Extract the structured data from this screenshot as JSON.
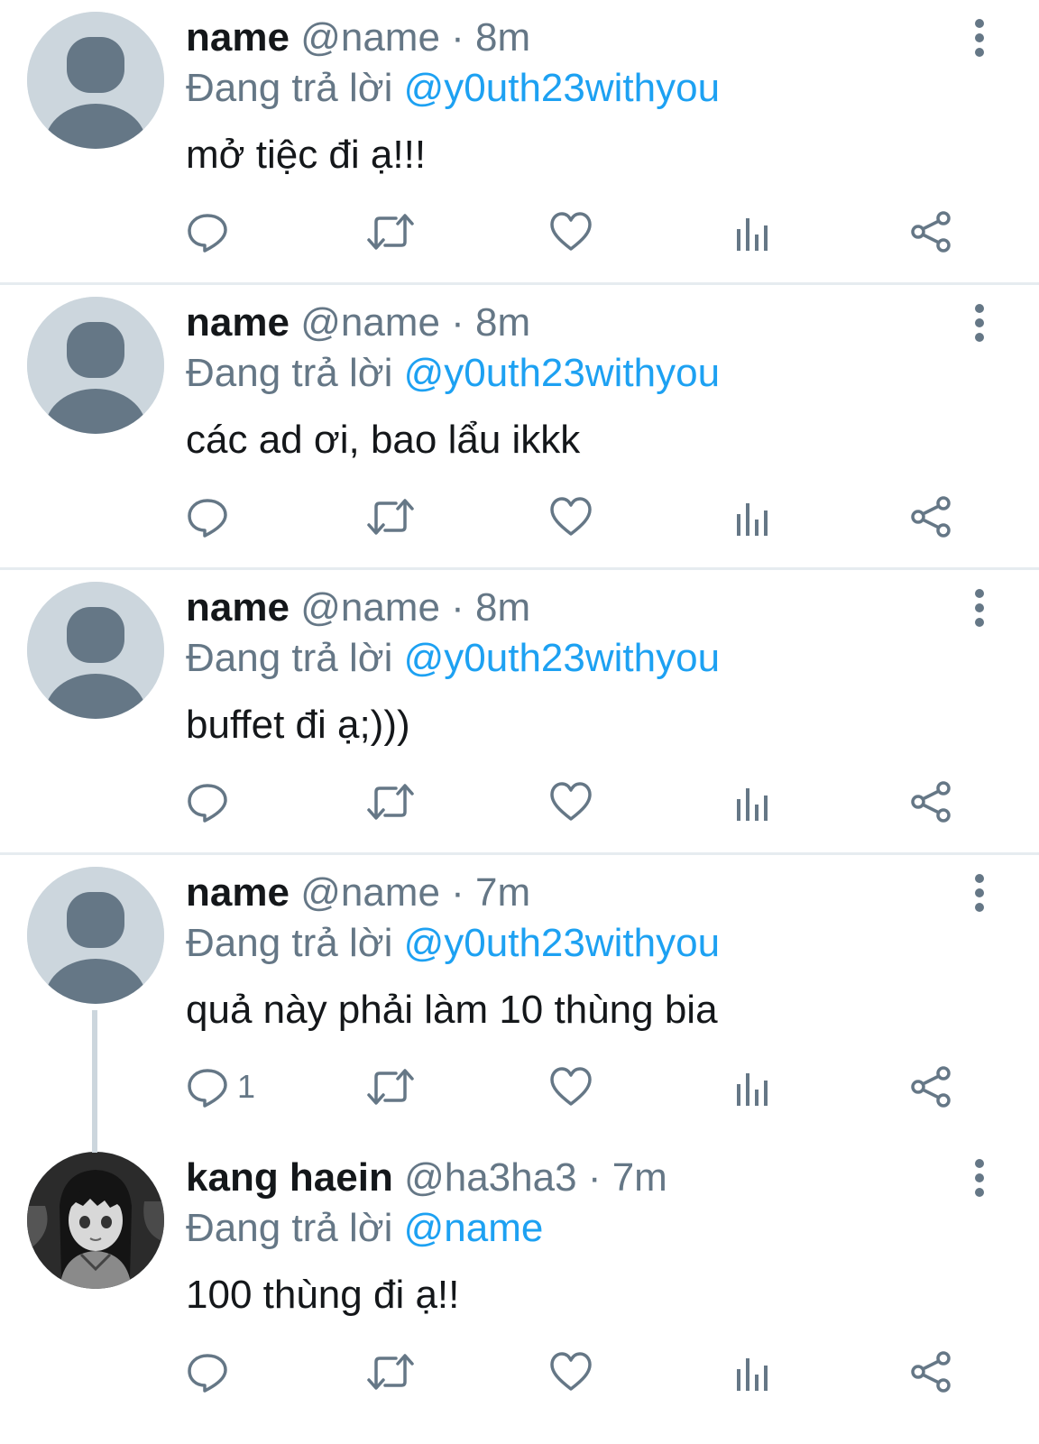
{
  "colors": {
    "text": "#14171a",
    "secondary": "#657786",
    "link": "#1da1f2",
    "divider": "#e6ecf0",
    "avatar_bg": "#ccd6dd",
    "avatar_fg": "#657786"
  },
  "tweets": [
    {
      "name": "name",
      "handle": "@name",
      "separator": "·",
      "time": "8m",
      "reply_prefix": "Đang trả lời",
      "reply_to": "@y0uth23withyou",
      "text": "mở tiệc đi ạ!!!",
      "reply_count": "",
      "avatar": "default-avatar"
    },
    {
      "name": "name",
      "handle": "@name",
      "separator": "·",
      "time": "8m",
      "reply_prefix": "Đang trả lời",
      "reply_to": "@y0uth23withyou",
      "text": "các ad ơi, bao lẩu ikkk",
      "reply_count": "",
      "avatar": "default-avatar"
    },
    {
      "name": "name",
      "handle": "@name",
      "separator": "·",
      "time": "8m",
      "reply_prefix": "Đang trả lời",
      "reply_to": "@y0uth23withyou",
      "text": "buffet đi ạ;)))",
      "reply_count": "",
      "avatar": "default-avatar"
    },
    {
      "name": "name",
      "handle": "@name",
      "separator": "·",
      "time": "7m",
      "reply_prefix": "Đang trả lời",
      "reply_to": "@y0uth23withyou",
      "text": "quả này phải làm 10 thùng bia",
      "reply_count": "1",
      "avatar": "default-avatar"
    },
    {
      "name": "kang haein",
      "handle": "@ha3ha3",
      "separator": "·",
      "time": "7m",
      "reply_prefix": "Đang trả lời",
      "reply_to": "@name",
      "text": "100 thùng đi ạ!!",
      "reply_count": "",
      "avatar": "anime-girl-avatar"
    }
  ],
  "icons": {
    "reply": "reply-icon",
    "retweet": "retweet-icon",
    "like": "heart-icon",
    "stats": "analytics-icon",
    "share": "share-icon",
    "more": "more-vertical-icon"
  }
}
